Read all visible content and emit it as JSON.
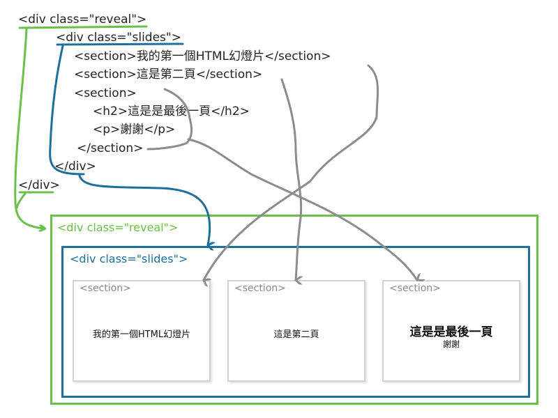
{
  "code": {
    "line1": "<div class=\"reveal\">",
    "line2": "<div class=\"slides\">",
    "line3": "<section>我的第一個HTML幻燈片</section>",
    "line4": "<section>這是第二頁</section>",
    "line5": "<section>",
    "line6": "<h2>這是是最後一頁</h2>",
    "line7": "<p>謝謝</p>",
    "line8": "</section>",
    "line9": "</div>",
    "line10": "</div>"
  },
  "preview": {
    "reveal_label": "<div class=\"reveal\">",
    "slides_label": "<div class=\"slides\">",
    "cards": [
      {
        "tag": "<section>",
        "text": "我的第一個HTML幻燈片"
      },
      {
        "tag": "<section>",
        "text": "這是第二頁"
      },
      {
        "tag": "<section>",
        "heading": "這是是最後一頁",
        "text": "謝謝"
      }
    ]
  },
  "colors": {
    "reveal": "#6cc04a",
    "slides": "#1f6f9a",
    "arrows": "#8c8c8c",
    "card_border": "#d2d2d2"
  }
}
